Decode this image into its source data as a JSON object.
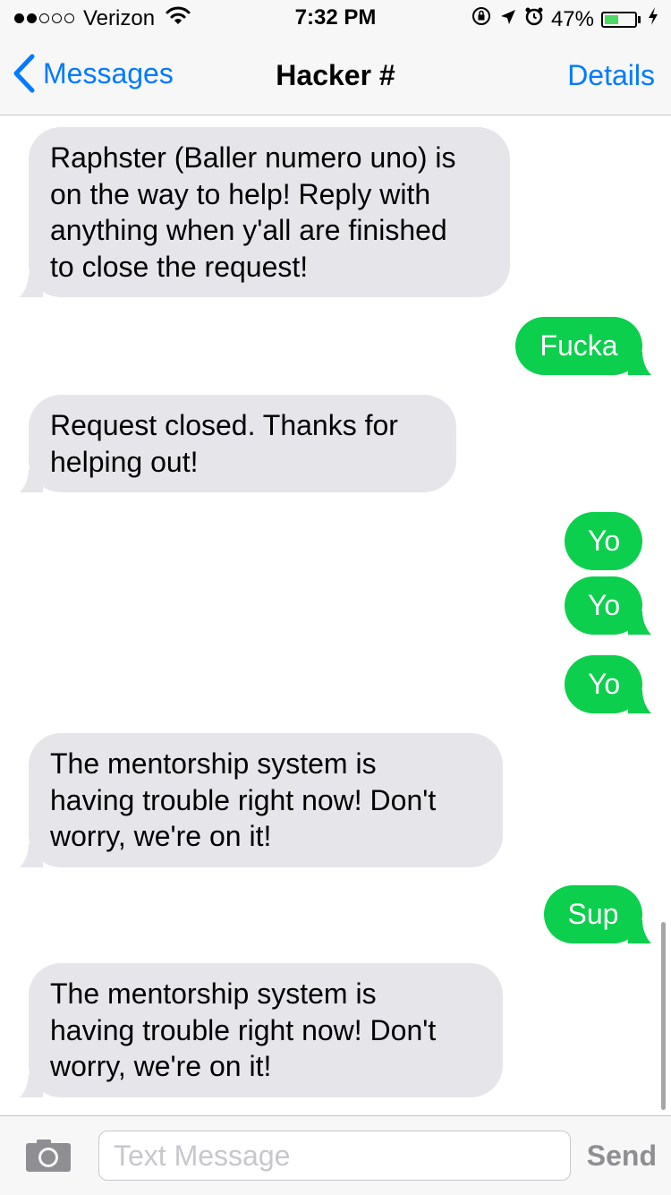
{
  "status": {
    "signal_filled": 2,
    "signal_total": 5,
    "carrier": "Verizon",
    "time": "7:32 PM",
    "battery_percent": "47%",
    "battery_level": 0.47
  },
  "nav": {
    "back_label": "Messages",
    "title": "Hacker #",
    "details_label": "Details"
  },
  "messages": [
    {
      "dir": "in",
      "lines": [
        "Raphster (Baller numero uno) is",
        "on the way to help! Reply with",
        "anything when y'all are finished",
        "to close the request!"
      ]
    },
    {
      "dir": "out",
      "lines": [
        "Fucka"
      ]
    },
    {
      "dir": "in",
      "lines": [
        "Request closed. Thanks for",
        "helping out!"
      ]
    },
    {
      "dir": "out",
      "lines": [
        "Yo"
      ]
    },
    {
      "dir": "out",
      "lines": [
        "Yo"
      ]
    },
    {
      "dir": "out",
      "lines": [
        "Yo"
      ]
    },
    {
      "dir": "in",
      "lines": [
        "The mentorship system is",
        "having trouble right now! Don't",
        "worry, we're on it!"
      ]
    },
    {
      "dir": "out",
      "lines": [
        "Sup"
      ]
    },
    {
      "dir": "in",
      "lines": [
        "The mentorship system is",
        "having trouble right now! Don't",
        "worry, we're on it!"
      ]
    }
  ],
  "input": {
    "placeholder": "Text Message",
    "send_label": "Send"
  },
  "colors": {
    "incoming_bubble": "#e5e5ea",
    "outgoing_bubble": "#0ccf4d",
    "accent": "#007aff",
    "battery_fill": "#4cd964"
  }
}
